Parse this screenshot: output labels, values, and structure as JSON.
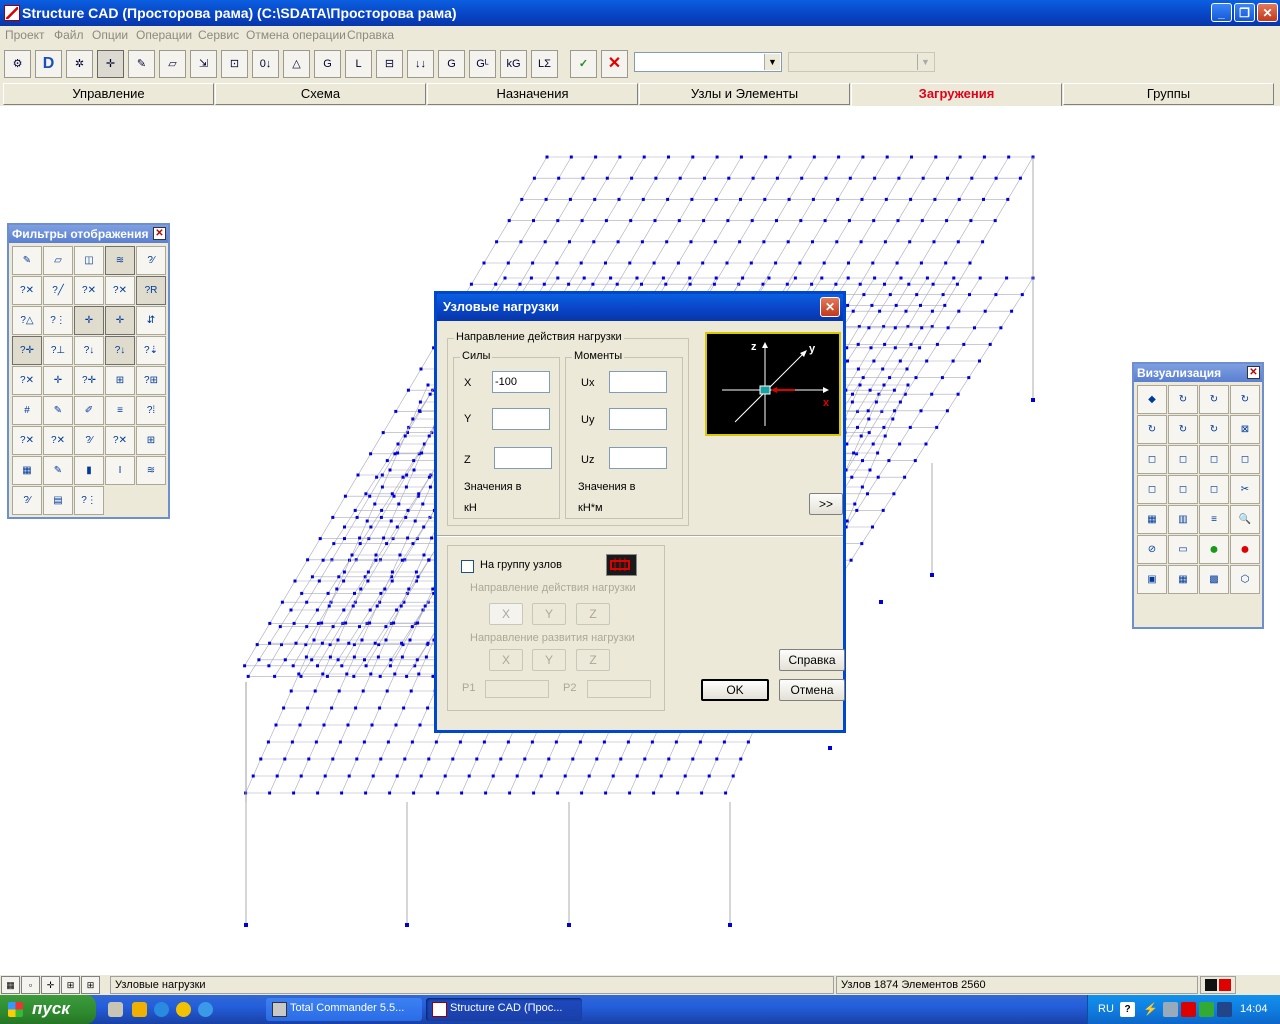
{
  "window": {
    "title": "Structure CAD (Просторова рама) (C:\\SDATA\\Просторова рама)"
  },
  "menu": [
    "Проект",
    "Файл",
    "Опции",
    "Операции",
    "Сервис",
    "Отмена операции",
    "Справка"
  ],
  "tabs": [
    "Управление",
    "Схема",
    "Назначения",
    "Узлы и Элементы",
    "Загружения",
    "Группы"
  ],
  "active_tab": "Загружения",
  "filters_panel": {
    "title": "Фильтры отображения"
  },
  "viz_panel": {
    "title": "Визуализация"
  },
  "dialog": {
    "title": "Узловые нагрузки",
    "direction_group": "Направление действия нагрузки",
    "forces_group": "Силы",
    "moments_group": "Моменты",
    "x_label": "X",
    "y_label": "Y",
    "z_label": "Z",
    "ux_label": "Ux",
    "uy_label": "Uy",
    "uz_label": "Uz",
    "x_value": "-100",
    "y_value": "",
    "z_value": "",
    "ux_value": "",
    "uy_value": "",
    "uz_value": "",
    "forces_units_label": "Значения в",
    "forces_units": "кН",
    "moments_units_label": "Значения в",
    "moments_units": "кН*м",
    "expand_button": ">>",
    "node_group_checkbox": "На группу узлов",
    "node_group_checked": false,
    "dir_action_label": "Направление действия нагрузки",
    "dir_develop_label": "Направление развития нагрузки",
    "axis_buttons": [
      "X",
      "Y",
      "Z"
    ],
    "p1_label": "P1",
    "p2_label": "P2",
    "help_button": "Справка",
    "ok_button": "OK",
    "cancel_button": "Отмена",
    "axes_preview": {
      "z": "z",
      "y": "y",
      "x": "x"
    }
  },
  "statusbar": {
    "message": "Узловые нагрузки",
    "stats": "Узлов 1874 Элементов 2560"
  },
  "taskbar": {
    "start_label": "пуск",
    "tasks": [
      "Total Commander 5.5...",
      "Structure CAD (Прос..."
    ],
    "lang": "RU",
    "clock": "14:04"
  },
  "colors": {
    "accent": "#0a5fe0",
    "active_tab": "#e0001a",
    "mesh_nodes": "#0000dd",
    "taskbar": "#245edb"
  }
}
